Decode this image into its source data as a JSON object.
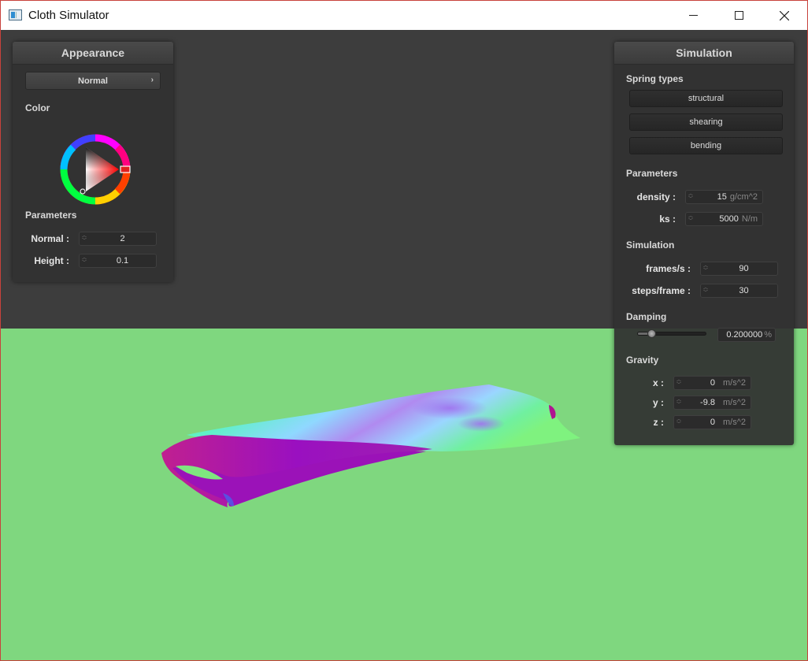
{
  "window": {
    "title": "Cloth Simulator"
  },
  "appearance": {
    "header": "Appearance",
    "shader_selected": "Normal",
    "color_label": "Color",
    "parameters_label": "Parameters",
    "normal": {
      "label": "Normal :",
      "value": "2"
    },
    "height": {
      "label": "Height :",
      "value": "0.1"
    },
    "accent_color": "#e02020"
  },
  "simulation": {
    "header": "Simulation",
    "spring_types_label": "Spring types",
    "spring_buttons": [
      "structural",
      "shearing",
      "bending"
    ],
    "parameters_label": "Parameters",
    "density": {
      "label": "density :",
      "value": "15",
      "unit": "g/cm^2"
    },
    "ks": {
      "label": "ks :",
      "value": "5000",
      "unit": "N/m"
    },
    "simulation_label": "Simulation",
    "frames": {
      "label": "frames/s :",
      "value": "90"
    },
    "steps": {
      "label": "steps/frame :",
      "value": "30"
    },
    "damping_label": "Damping",
    "damping": {
      "value": "0.200000",
      "unit": "%",
      "fraction": 0.2
    },
    "gravity_label": "Gravity",
    "gx": {
      "label": "x :",
      "value": "0",
      "unit": "m/s^2"
    },
    "gy": {
      "label": "y :",
      "value": "-9.8",
      "unit": "m/s^2"
    },
    "gz": {
      "label": "z :",
      "value": "0",
      "unit": "m/s^2"
    }
  },
  "colors": {
    "ground": "#7fd77f",
    "background": "#3d3d3d"
  }
}
